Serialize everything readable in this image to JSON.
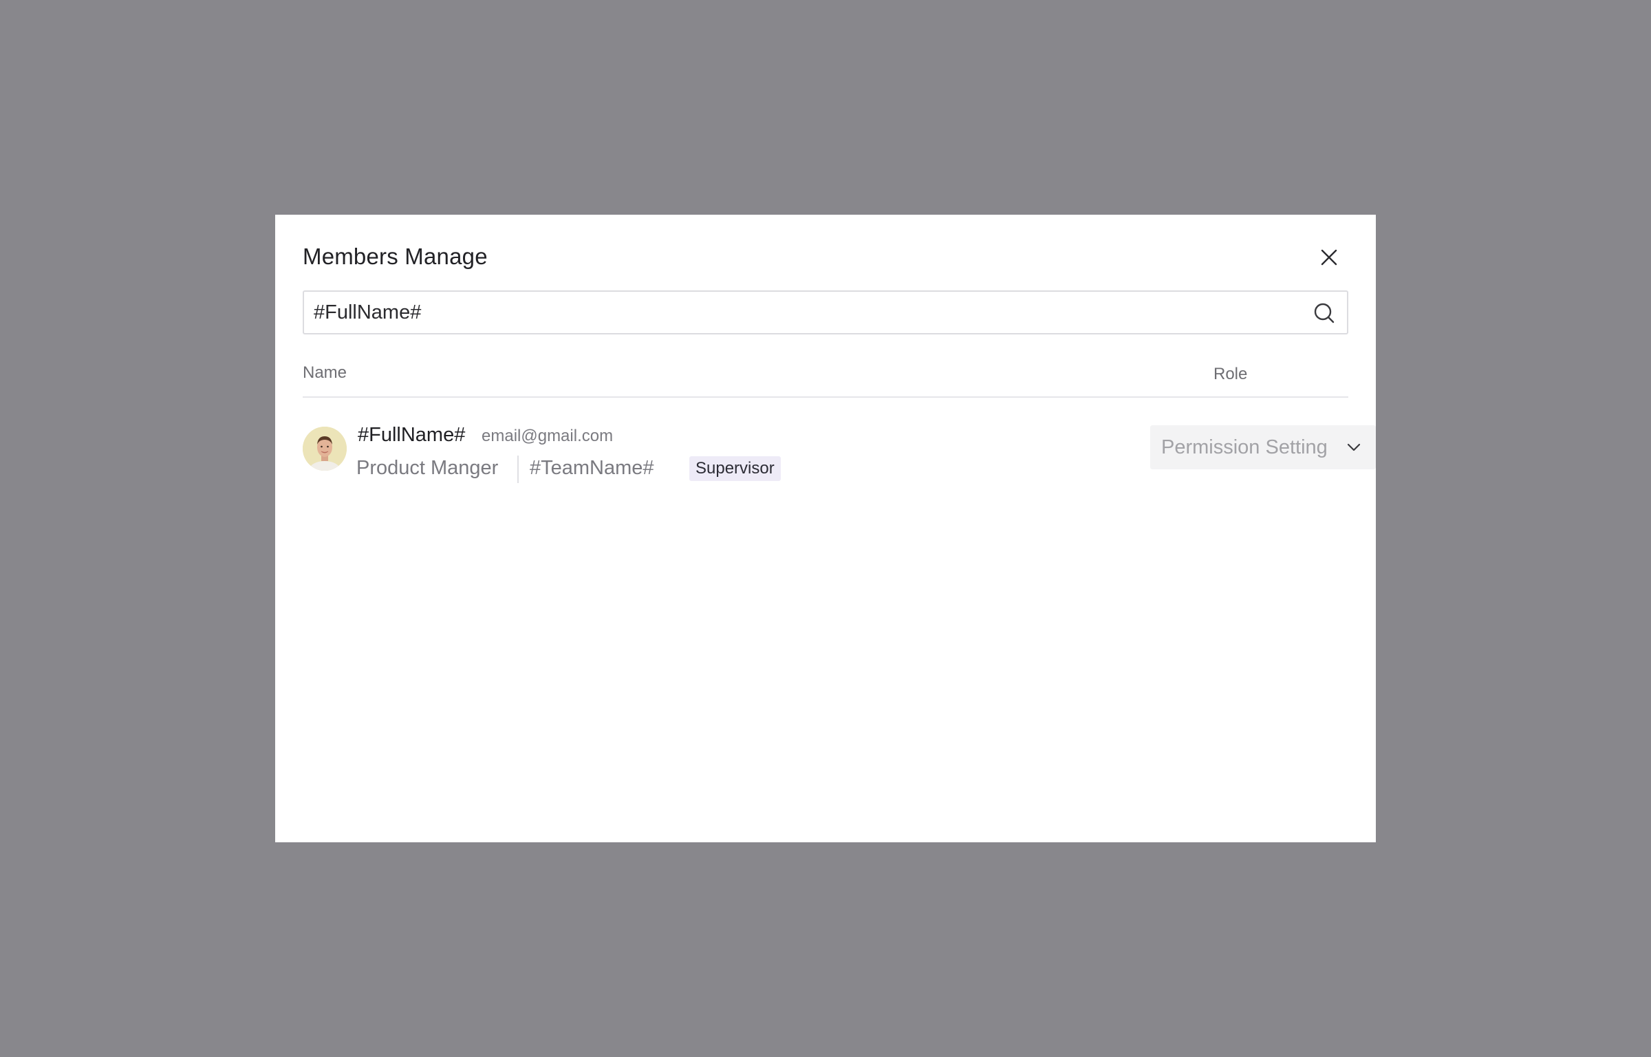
{
  "modal": {
    "title": "Members Manage",
    "close_icon": "close-icon"
  },
  "search": {
    "value": "#FullName#",
    "placeholder": "",
    "icon": "search-icon"
  },
  "table": {
    "columns": {
      "name": "Name",
      "role": "Role"
    },
    "members": [
      {
        "full_name": "#FullName#",
        "email": "email@gmail.com",
        "job_title": "Product Manger",
        "team": "#TeamName#",
        "badge": "Supervisor",
        "avatar_icon": "avatar-photo",
        "permission": {
          "label": "Permission Setting",
          "icon": "chevron-down-icon"
        }
      }
    ]
  },
  "colors": {
    "overlay": "#88878c",
    "modal_bg": "#ffffff",
    "badge_bg": "#eeebf7",
    "select_bg": "#f3f3f4",
    "muted_text": "#7a7a80"
  }
}
